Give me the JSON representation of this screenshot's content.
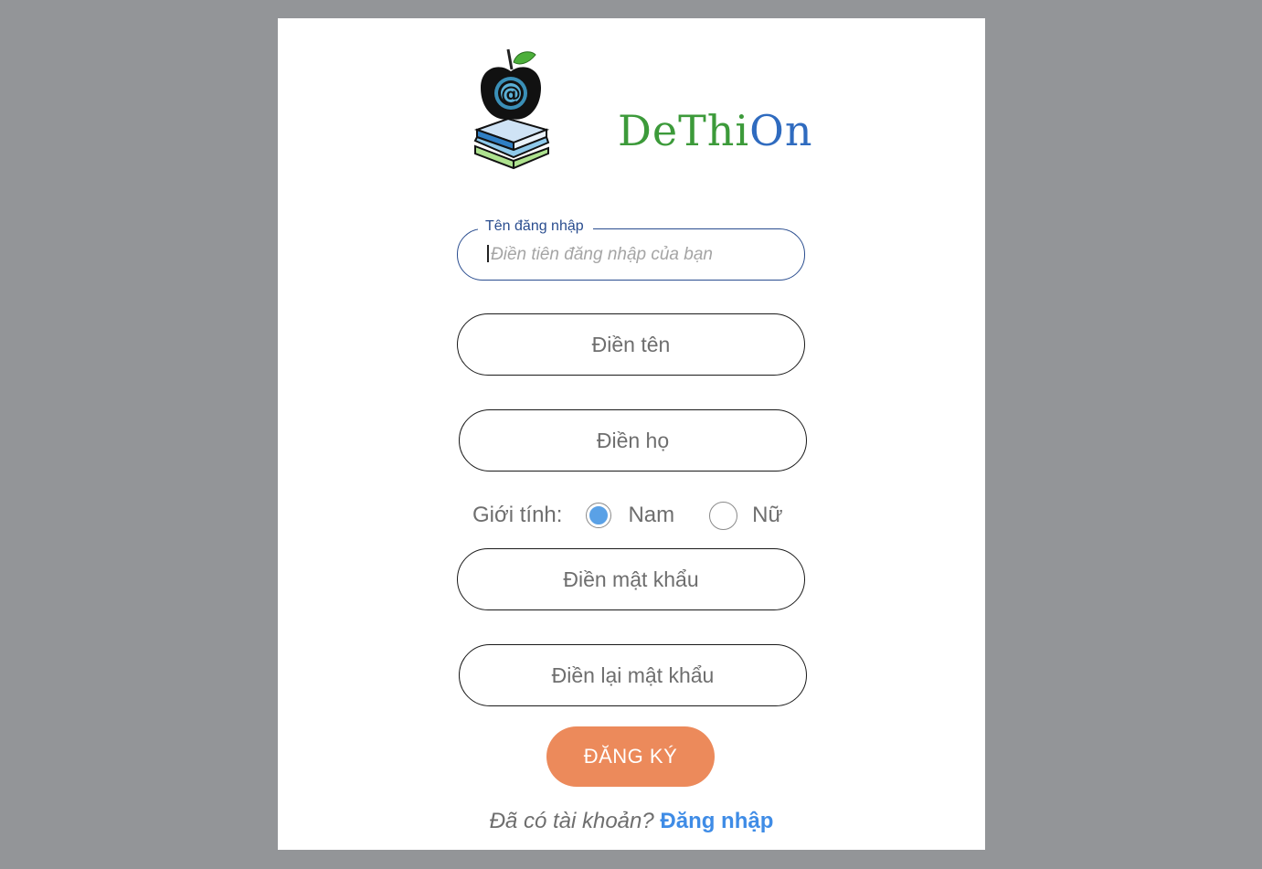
{
  "brand": {
    "name_part1": "DeThi",
    "name_part2": "On",
    "logo_icon": "apple-books-at-icon"
  },
  "form": {
    "username": {
      "label": "Tên đăng nhập",
      "placeholder": "Điền tiên đăng nhập của bạn"
    },
    "first_name_placeholder": "Điền tên",
    "last_name_placeholder": "Điền họ",
    "gender": {
      "label": "Giới tính:",
      "options": [
        {
          "label": "Nam",
          "selected": true
        },
        {
          "label": "Nữ",
          "selected": false
        }
      ]
    },
    "password_placeholder": "Điền mật khẩu",
    "confirm_password_placeholder": "Điền lại mật khẩu",
    "submit_label": "ĐĂNG KÝ"
  },
  "footer": {
    "question": "Đã có tài khoản?",
    "login_link": "Đăng nhập"
  },
  "colors": {
    "background": "#939598",
    "accent_button": "#ec8a5b",
    "radio_selected": "#5aa1e6",
    "link": "#3f8ce6",
    "brand_green": "#3c9a3a",
    "brand_blue": "#2f6bbf",
    "focus_border": "#2a4d8f"
  }
}
